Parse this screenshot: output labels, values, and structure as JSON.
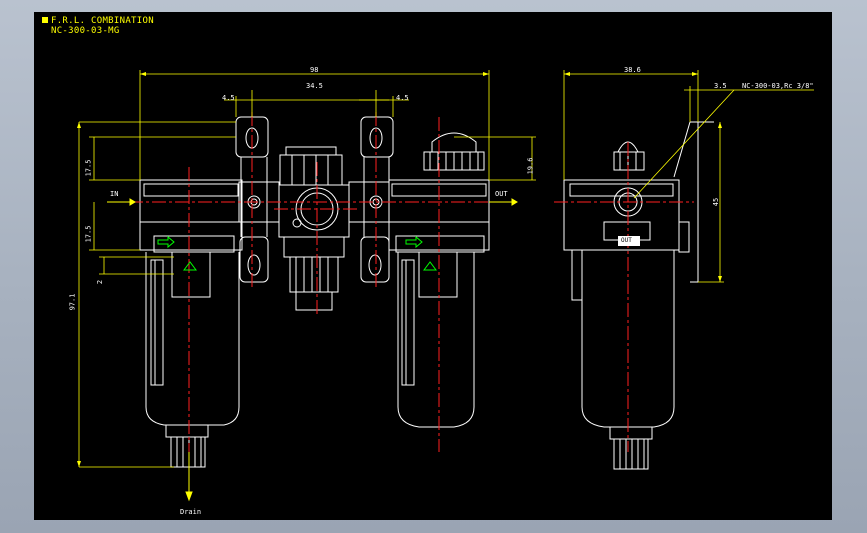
{
  "title": {
    "line1": "F.R.L. COMBINATION",
    "line2": "NC-300-03-MG"
  },
  "dimensions": {
    "overall_width": "98",
    "bracket_left": "4.5",
    "bracket_span": "34.5",
    "bracket_right": "4.5",
    "side_width": "38.6",
    "side_offset": "3.5",
    "side_callout": "NC-300-03,Rc 3/8\"",
    "height_top": "17.5",
    "height_mid": "17.5",
    "height_gap": "2",
    "height_total": "97.1",
    "height_cap": "19.6",
    "height_side": "45"
  },
  "labels": {
    "in": "IN",
    "out": "OUT",
    "drain": "Drain",
    "out_port": "OUT"
  },
  "colors": {
    "background": "#000000",
    "outline": "#ffffff",
    "centerline": "#ff2020",
    "dimension": "#ffff00",
    "symbol": "#00ff00"
  }
}
